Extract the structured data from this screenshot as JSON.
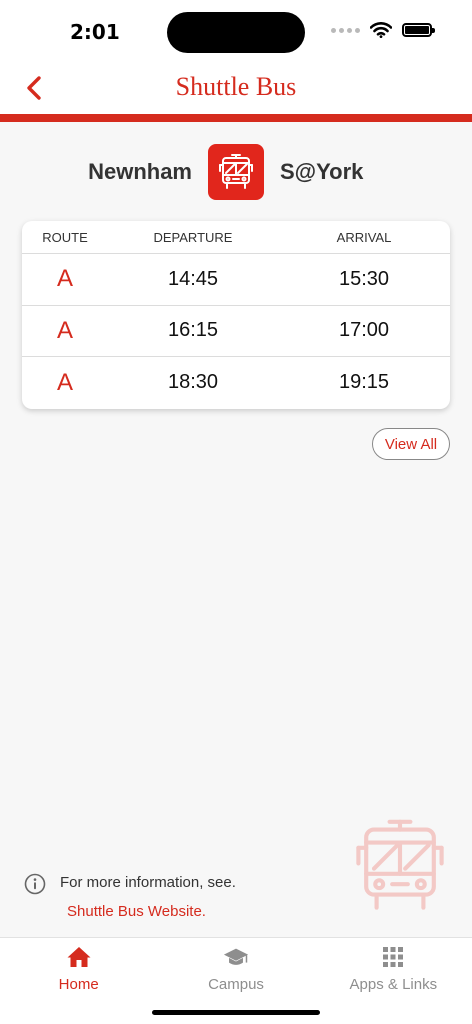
{
  "status_bar": {
    "time": "2:01"
  },
  "nav": {
    "title": "Shuttle Bus"
  },
  "route": {
    "from": "Newnham",
    "to": "S@York"
  },
  "timetable": {
    "headers": {
      "route": "ROUTE",
      "departure": "DEPARTURE",
      "arrival": "ARRIVAL"
    },
    "rows": [
      {
        "route": "A",
        "departure": "14:45",
        "arrival": "15:30"
      },
      {
        "route": "A",
        "departure": "16:15",
        "arrival": "17:00"
      },
      {
        "route": "A",
        "departure": "18:30",
        "arrival": "19:15"
      }
    ]
  },
  "view_all_label": "View All",
  "info": {
    "text": "For more information, see.",
    "link_label": "Shuttle Bus Website."
  },
  "tabs": [
    {
      "label": "Home",
      "icon": "home-icon",
      "active": true
    },
    {
      "label": "Campus",
      "icon": "graduation-cap-icon",
      "active": false
    },
    {
      "label": "Apps & Links",
      "icon": "grid-icon",
      "active": false
    }
  ],
  "colors": {
    "accent": "#d52b1e",
    "badge": "#e1261c",
    "inactive": "#8e8e8e"
  }
}
